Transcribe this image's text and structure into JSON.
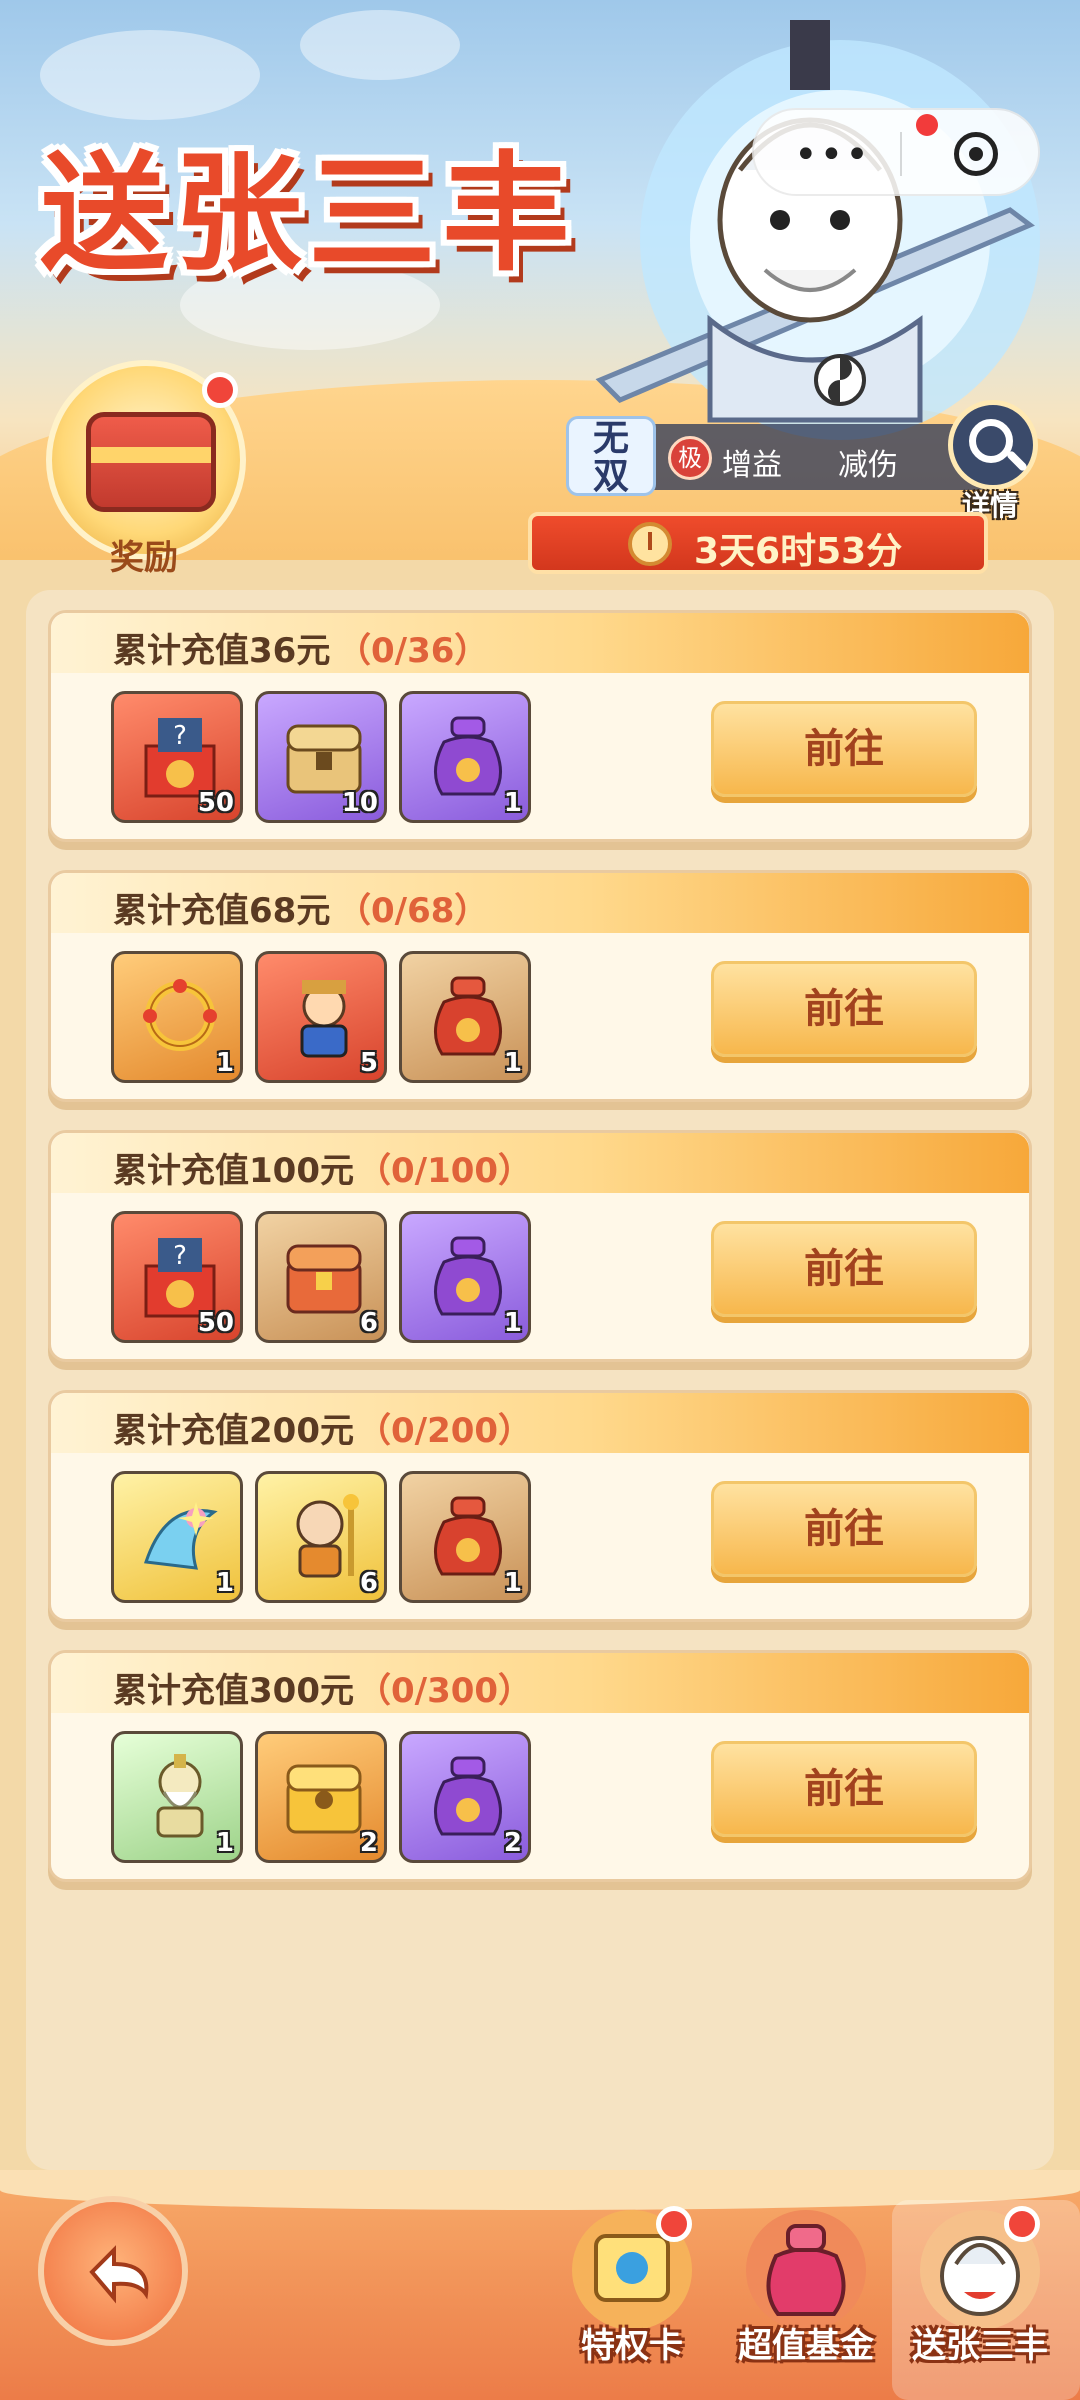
{
  "header": {
    "title": "送张三丰",
    "reward_label": "奖励",
    "detail_label": "详情",
    "buffs": {
      "wushuang_top": "无",
      "wushuang_bottom": "双",
      "ji": "极",
      "gain": "增益",
      "reduce": "减伤"
    },
    "timer": "3天6时53分"
  },
  "tiers": [
    {
      "title": "累计充值36元",
      "progress": "（0/36）",
      "button": "前往",
      "items": [
        {
          "icon": "mystery-box-icon",
          "count": "50",
          "color": "red"
        },
        {
          "icon": "treasure-chest-icon",
          "count": "10",
          "color": "purple"
        },
        {
          "icon": "lucky-bag-icon",
          "count": "1",
          "color": "purple"
        }
      ]
    },
    {
      "title": "累计充值68元",
      "progress": "（0/68）",
      "button": "前往",
      "items": [
        {
          "icon": "golden-ring-icon",
          "count": "1",
          "color": "orange"
        },
        {
          "icon": "hero-portrait-icon",
          "count": "5",
          "color": "red"
        },
        {
          "icon": "lucky-bag-icon",
          "count": "1",
          "color": "tan"
        }
      ]
    },
    {
      "title": "累计充值100元",
      "progress": "（0/100）",
      "button": "前往",
      "items": [
        {
          "icon": "mystery-box-icon",
          "count": "50",
          "color": "red"
        },
        {
          "icon": "treasure-chest-icon",
          "count": "6",
          "color": "tan"
        },
        {
          "icon": "lucky-bag-icon",
          "count": "1",
          "color": "purple"
        }
      ]
    },
    {
      "title": "累计充值200元",
      "progress": "（0/200）",
      "button": "前往",
      "items": [
        {
          "icon": "wing-ornament-icon",
          "count": "1",
          "color": "gold"
        },
        {
          "icon": "monk-hero-icon",
          "count": "6",
          "color": "gold"
        },
        {
          "icon": "lucky-bag-icon",
          "count": "1",
          "color": "tan"
        }
      ]
    },
    {
      "title": "累计充值300元",
      "progress": "（0/300）",
      "button": "前往",
      "items": [
        {
          "icon": "sage-hero-icon",
          "count": "1",
          "color": "mint"
        },
        {
          "icon": "golden-chest-icon",
          "count": "2",
          "color": "orange"
        },
        {
          "icon": "lucky-bag-icon",
          "count": "2",
          "color": "purple"
        }
      ]
    }
  ],
  "bottom_nav": [
    {
      "label": "特权卡",
      "icon": "privilege-card-icon"
    },
    {
      "label": "超值基金",
      "icon": "fund-bag-icon"
    },
    {
      "label": "送张三丰",
      "icon": "zhangsanfeng-icon"
    }
  ],
  "colors": {
    "accent": "#e84a2a",
    "button_text": "#a2431e",
    "progress_text": "#e0623a",
    "badge_red": "#f0453a"
  }
}
